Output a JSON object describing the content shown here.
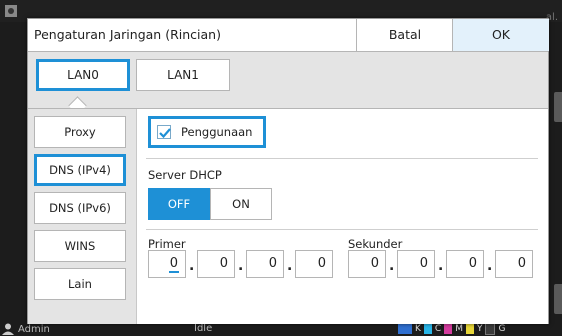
{
  "background": {
    "right_text": "al.",
    "status": {
      "user": "Admin",
      "state": "Idle"
    },
    "inks": [
      {
        "label": "K",
        "color": "#2f6fd0"
      },
      {
        "label": "C",
        "color": "#29b6e8"
      },
      {
        "label": "M",
        "color": "#d43c9e"
      },
      {
        "label": "Y",
        "color": "#e8d73a"
      },
      {
        "label": "G",
        "color": "#3b3b3b"
      }
    ]
  },
  "dialog": {
    "title": "Pengaturan Jaringan (Rincian)",
    "cancel_label": "Batal",
    "ok_label": "OK"
  },
  "tabs": [
    {
      "label": "LAN0",
      "selected": true
    },
    {
      "label": "LAN1",
      "selected": false
    }
  ],
  "sidebar": {
    "items": [
      {
        "label": "Proxy",
        "selected": false
      },
      {
        "label": "DNS (IPv4)",
        "selected": true
      },
      {
        "label": "DNS (IPv6)",
        "selected": false
      },
      {
        "label": "WINS",
        "selected": false
      },
      {
        "label": "Lain",
        "selected": false
      }
    ]
  },
  "usage": {
    "label": "Penggunaan",
    "checked": true
  },
  "dhcp": {
    "label": "Server DHCP",
    "off_label": "OFF",
    "on_label": "ON",
    "value": "OFF"
  },
  "primary": {
    "label": "Primer",
    "octets": [
      "0",
      "0",
      "0",
      "0"
    ]
  },
  "secondary": {
    "label": "Sekunder",
    "octets": [
      "0",
      "0",
      "0",
      "0"
    ]
  },
  "colors": {
    "accent": "#1e90d6",
    "ok_bg": "#e3f1fb",
    "panel_bg": "#e4e4e4"
  }
}
